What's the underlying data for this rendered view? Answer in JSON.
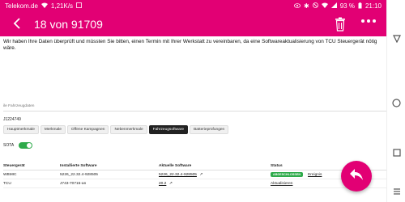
{
  "status_bar": {
    "carrier": "Telekom.de",
    "speed": "1,21K/s",
    "battery": "93 %",
    "time": "21:10"
  },
  "app_bar": {
    "title": "18 von 91709",
    "back_icon": "chevron-left-icon",
    "delete_icon": "trash-icon",
    "more_icon": "more-dots-icon"
  },
  "message": {
    "text": "Wir haben Ihre Daten überprüft und müssten Sie bitten, einen Termin mit Ihrer Werkstatt zu vereinbaren, da eine Softwareaktualisierung von TCU Steuergerät nötig wäre."
  },
  "vehicle": {
    "section_label": "ile Fahrzeugdaten",
    "id": "J1224749"
  },
  "tabs": [
    {
      "label": "Hauptmerkmale",
      "active": false
    },
    {
      "label": "Merkmale",
      "active": false
    },
    {
      "label": "Offene Kampagnen",
      "active": false
    },
    {
      "label": "Nebenmerkmale",
      "active": false
    },
    {
      "label": "Fahrzeugsoftware",
      "active": true
    },
    {
      "label": "Batterieprüfungen",
      "active": false
    }
  ],
  "sota": {
    "label": "SOTA",
    "enabled": true
  },
  "table": {
    "headers": [
      "Steuergerät",
      "Installierte Software",
      "Aktuelle Software",
      "Status"
    ],
    "rows": [
      {
        "unit": "WBMIC",
        "installed": "5226_22.32.4-928505",
        "current": "5226_22.32.4-928505",
        "badge": "ABGESCHLOSSEN",
        "status_link": "Ereignis"
      },
      {
        "unit": "TCU",
        "installed": "J743-70715-an",
        "current": "20.2",
        "badge": "",
        "status_link": "Aktualisieren"
      }
    ]
  },
  "colors": {
    "brand": "#e20074",
    "success": "#2eaa4a"
  },
  "fab": {
    "icon": "reply-icon"
  },
  "nav_bar": {
    "icons": [
      "back-triangle-icon",
      "home-circle-icon",
      "recents-square-icon",
      "menu-lines-icon"
    ]
  }
}
